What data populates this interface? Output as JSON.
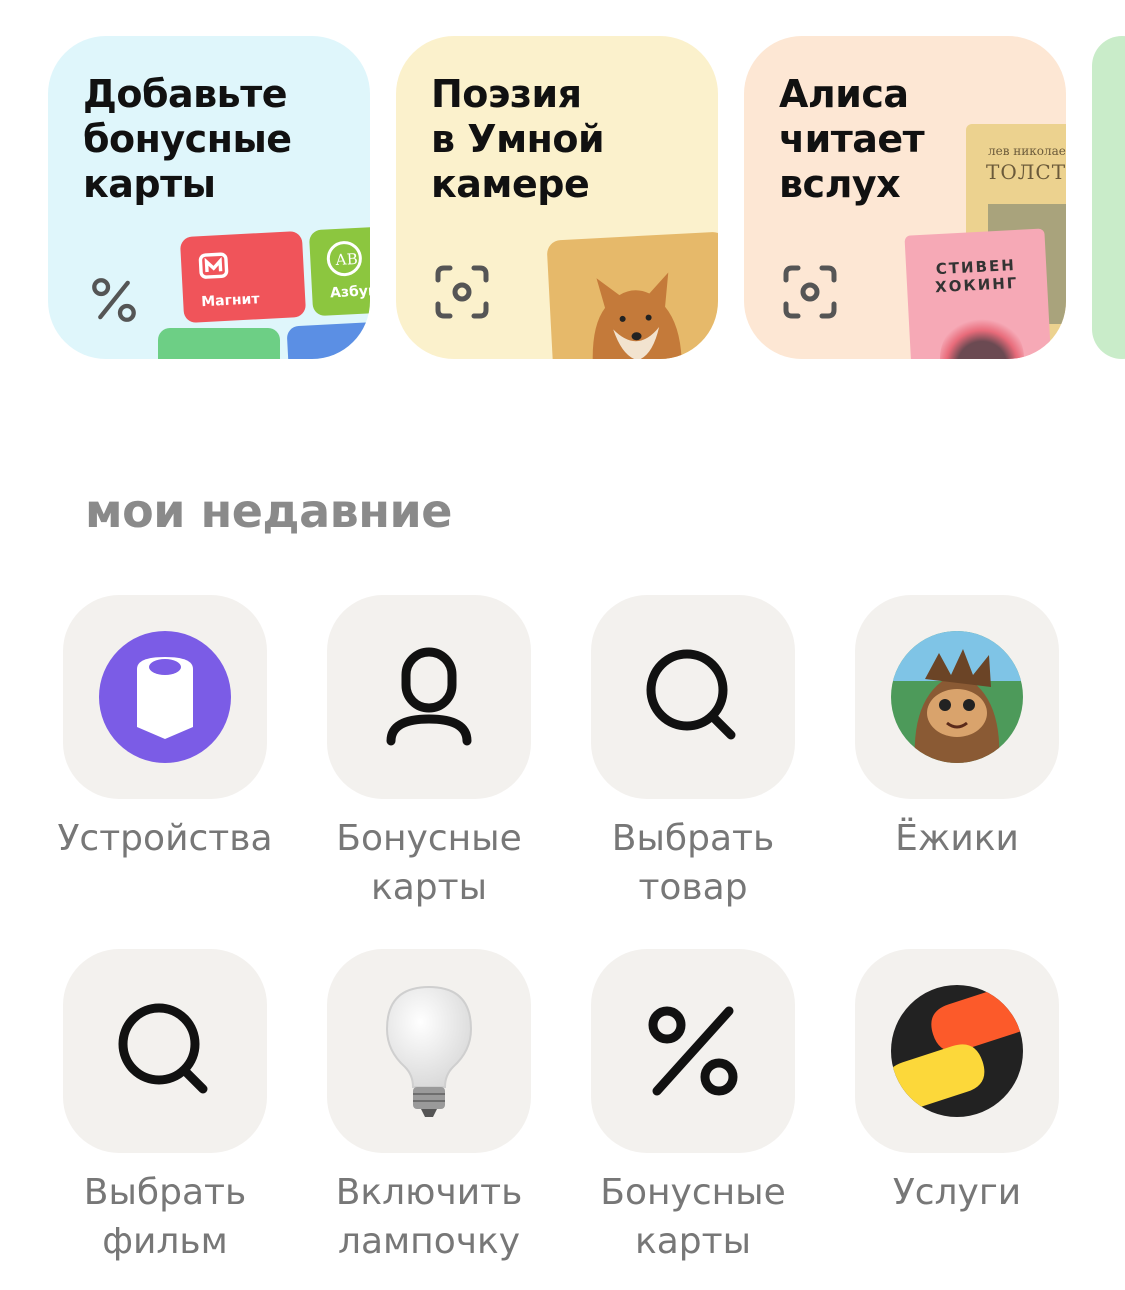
{
  "promo_cards": [
    {
      "title": "Добавьте\nбонусные\nкарты",
      "bg": "#dff6fb",
      "icon": "percent-icon",
      "brands": [
        "Магнит",
        "Азбука"
      ]
    },
    {
      "title": "Поэзия\nв Умной\nкамере",
      "bg": "#fbf1cc",
      "icon": "camera-scan-icon"
    },
    {
      "title": "Алиса\nчитает\nвслух",
      "bg": "#fde7d4",
      "icon": "camera-scan-icon",
      "book1_author": "лев николаев",
      "book1_title": "ТОЛСТО",
      "book2_title": "СТИВЕН\nХОКИНГ"
    }
  ],
  "recent": {
    "title": "мои недавние",
    "items": [
      {
        "label": "Устройства",
        "icon": "device-icon"
      },
      {
        "label": "Бонусные\nкарты",
        "icon": "person-icon"
      },
      {
        "label": "Выбрать\nтовар",
        "icon": "search-icon"
      },
      {
        "label": "Ёжики",
        "icon": "hedgehog-avatar-icon"
      },
      {
        "label": "Выбрать\nфильм",
        "icon": "search-icon"
      },
      {
        "label": "Включить\nлампочку",
        "icon": "lightbulb-icon"
      },
      {
        "label": "Бонусные\nкарты",
        "icon": "percent-icon"
      },
      {
        "label": "Услуги",
        "icon": "services-logo-icon"
      }
    ]
  },
  "colors": {
    "accent_purple": "#7b5ce6",
    "magnit_red": "#f0545a",
    "azbuka_green": "#8cc63f"
  }
}
